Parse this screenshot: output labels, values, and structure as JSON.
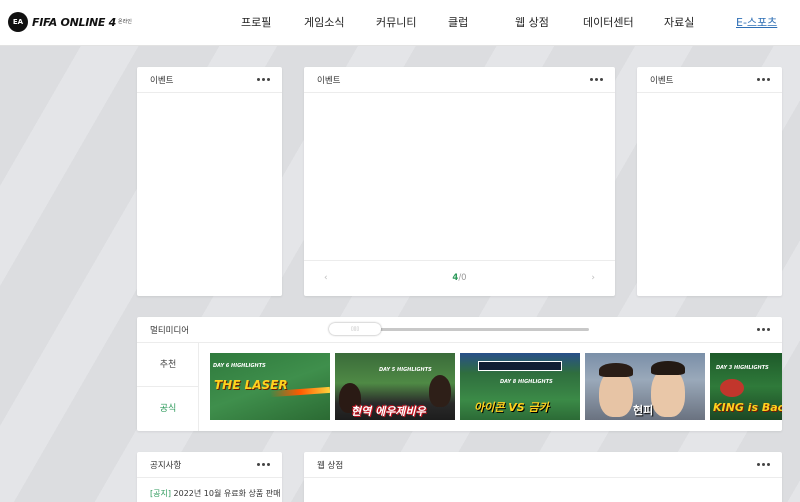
{
  "header": {
    "logo_badge": "EA",
    "logo_text": "FIFA ONLINE 4",
    "logo_small": "온라인",
    "nav": [
      "프로필",
      "게임소식",
      "커뮤니티",
      "클럽",
      "웹 상점",
      "데이터센터",
      "자료실",
      "E-스포츠"
    ]
  },
  "cards": {
    "event_left": {
      "title": "이벤트"
    },
    "event_center": {
      "title": "이벤트",
      "page_current": "4",
      "page_total": "/0",
      "prev_icon": "‹",
      "next_icon": "›"
    },
    "event_right": {
      "title": "이벤트"
    }
  },
  "multimedia": {
    "title": "멀티미디어",
    "scroll_thumb_label": "▯▯▯",
    "tabs": [
      "추천",
      "공식"
    ],
    "thumbnails": [
      {
        "text": "THE LASER",
        "sub": "DAY 6 HIGHLIGHTS"
      },
      {
        "text": "현역 에우제비우",
        "sub": "DAY 5 HIGHLIGHTS"
      },
      {
        "text": "아이콘 VS 금카",
        "sub": "DAY 8 HIGHLIGHTS"
      },
      {
        "text": "현피",
        "sub": ""
      },
      {
        "text": "KING is Bac",
        "sub": "DAY 3 HIGHLIGHTS"
      }
    ]
  },
  "notice": {
    "title": "공지사항",
    "items": [
      {
        "tag": "[공지]",
        "text": " 2022년 10월 유료화 상품 판매 안"
      }
    ]
  },
  "webshop": {
    "title": "웹 상점"
  },
  "colors": {
    "accent_green": "#2d9a5b",
    "link_blue": "#2f6fb5"
  }
}
